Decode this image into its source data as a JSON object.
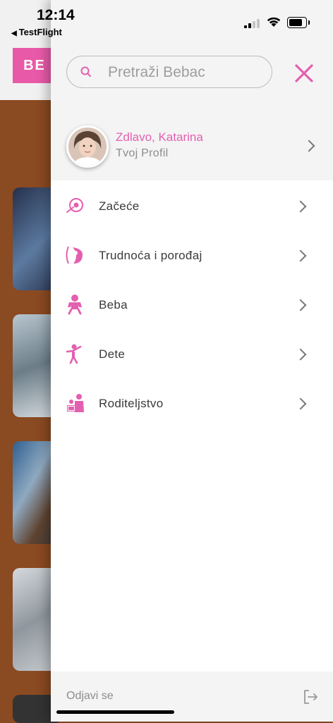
{
  "status_bar": {
    "time": "12:14",
    "back_app": "TestFlight",
    "signal_bars": 2,
    "battery_level": 0.8
  },
  "background": {
    "logo_text": "BE"
  },
  "drawer": {
    "search": {
      "placeholder": "Pretraži Bebac"
    },
    "profile": {
      "greeting": "Zdlavo, Katarina",
      "subtitle": "Tvoj Profil"
    },
    "menu_items": [
      {
        "label": "Začeće",
        "icon": "conception-icon"
      },
      {
        "label": "Trudnoća i porođaj",
        "icon": "pregnancy-icon"
      },
      {
        "label": "Beba",
        "icon": "baby-icon"
      },
      {
        "label": "Dete",
        "icon": "child-icon"
      },
      {
        "label": "Roditeljstvo",
        "icon": "parenting-icon"
      }
    ],
    "logout_label": "Odjavi se"
  },
  "colors": {
    "accent": "#e45fb0",
    "drawer_bg": "#f4f4f4",
    "menu_bg": "#ffffff",
    "background_content": "#8a4a22"
  }
}
